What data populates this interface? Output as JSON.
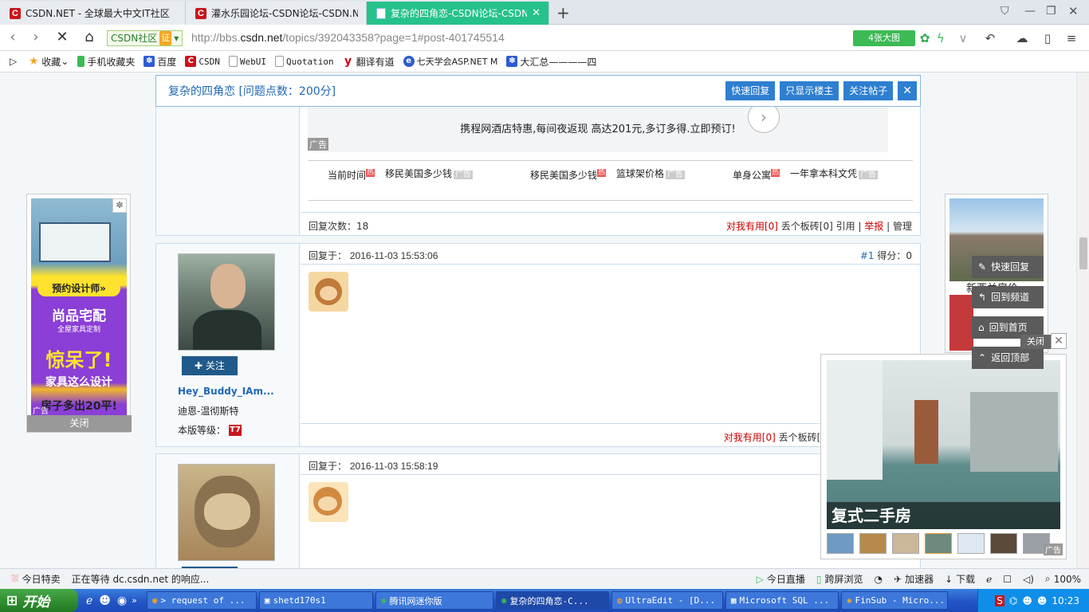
{
  "browser": {
    "tabs": [
      {
        "title": "CSDN.NET - 全球最大中文IT社区",
        "active": false
      },
      {
        "title": "灌水乐园论坛-CSDN论坛-CSDN.NE",
        "active": false
      },
      {
        "title": "复杂的四角恋-CSDN论坛-CSDN.NE",
        "active": true
      }
    ],
    "new_tab": "+",
    "badge": "CSDN社区",
    "badge_cert": "证",
    "url_prefix": "http://bbs.",
    "url_domain": "csdn.net",
    "url_path": "/topics/392043358?page=1#post-401745514",
    "bigimg": "4张大图",
    "bookmarks": [
      {
        "label": "收藏",
        "icon": "star-icon"
      },
      {
        "label": "手机收藏夹",
        "icon": "phone-icon"
      },
      {
        "label": "百度",
        "icon": "baidu-icon"
      },
      {
        "label": "CSDN",
        "icon": "csdn-icon"
      },
      {
        "label": "WebUI",
        "icon": "doc-icon"
      },
      {
        "label": "Quotation",
        "icon": "doc-icon"
      },
      {
        "label": "翻译有道",
        "icon": "youdao-icon"
      },
      {
        "label": "七天学会ASP.NET M",
        "icon": "ie-icon"
      },
      {
        "label": "大汇总————四",
        "icon": "baidu-icon"
      }
    ]
  },
  "sticky": {
    "title": "复杂的四角恋 [问题点数：200分]",
    "quick_reply": "快速回复",
    "only_op": "只显示楼主",
    "follow_post": "关注帖子",
    "close": "✕"
  },
  "topad": {
    "text": "携程网酒店特惠,每间夜返现 高达201元,多订多得.立即预订!",
    "ad_label": "广告",
    "links": [
      {
        "text": "当前时间",
        "hot": "热"
      },
      {
        "text": "移民美国多少钱",
        "ad": "广告"
      },
      {
        "text": "移民美国多少钱",
        "hot": "热"
      },
      {
        "text": "篮球架价格",
        "ad": "广告"
      },
      {
        "text": "单身公寓",
        "hot": "热"
      },
      {
        "text": "一年拿本科文凭",
        "ad": "广告"
      }
    ]
  },
  "op_footer": {
    "reply_count": "回复次数：18",
    "useful": "对我有用[0]",
    "brick": "丢个板砖[0]",
    "quote": "引用",
    "report": "举报",
    "manage": "管理"
  },
  "reply1": {
    "time_label": "回复于：",
    "time": "2016-11-03 15:53:06",
    "floor": "#1",
    "score": "得分：0",
    "follow": "关注",
    "username": "Hey_Buddy_IAm...",
    "nickname": "迪恩-温彻斯特",
    "level_label": "本版等级：",
    "level": "T7",
    "useful": "对我有用[0]",
    "brick": "丢个板砖[("
  },
  "reply2": {
    "time_label": "回复于：",
    "time": "2016-11-03 15:58:19"
  },
  "left_ad": {
    "btn": "预约设计师»",
    "brand": "尚品宅配",
    "brand_sub": "全屋家具定制",
    "slogan1": "惊呆了!",
    "slogan2": "家具这么设计",
    "slogan3": "房子多出20平!",
    "ad": "广告",
    "close": "关闭"
  },
  "right_ad": {
    "caption": "新西兰房价",
    "close": "关闭"
  },
  "video_ad": {
    "caption": "复式二手房",
    "ad": "广告"
  },
  "float_buttons": [
    "快速回复",
    "回到频道",
    "回到首页",
    "返回顶部"
  ],
  "status": {
    "today_sale": "今日特卖",
    "waiting": "正在等待 dc.csdn.net 的响应...",
    "live": "今日直播",
    "cross_screen": "跨屏浏览",
    "accelerator": "加速器",
    "download": "下载",
    "zoom": "100%"
  },
  "taskbar": {
    "start": "开始",
    "tasks": [
      "> request of ...",
      "shetd170s1",
      "腾讯网迷你版",
      "复杂的四角恋-C...",
      "UltraEdit - [D...",
      "Microsoft SQL ...",
      "FinSub - Micro..."
    ],
    "clock": "10:23"
  }
}
